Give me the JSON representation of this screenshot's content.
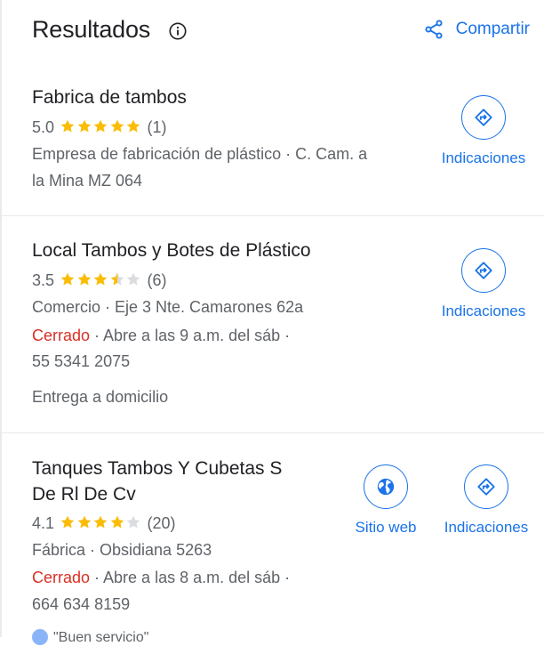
{
  "header": {
    "title": "Resultados",
    "share_label": "Compartir"
  },
  "results": [
    {
      "name": "Fabrica de tambos",
      "rating": "5.0",
      "stars": 5,
      "reviews": "(1)",
      "line1": "Empresa de fabricación de plástico · C. Cam. a",
      "line2": "la Mina MZ 064",
      "directions_label": "Indicaciones"
    },
    {
      "name": "Local Tambos y Botes de Plástico",
      "rating": "3.5",
      "stars": 3.5,
      "reviews": "(6)",
      "line1": "Comercio · Eje 3 Nte. Camarones 62a",
      "status": "Cerrado",
      "hours": " · Abre a las 9 a.m. del sáb ·",
      "phone": "55 5341 2075",
      "extra": "Entrega a domicilio",
      "directions_label": "Indicaciones"
    },
    {
      "name_line1": "Tanques Tambos Y Cubetas S",
      "name_line2": "De Rl De Cv",
      "rating": "4.1",
      "stars": 4,
      "reviews": "(20)",
      "line1": "Fábrica · Obsidiana 5263",
      "status": "Cerrado",
      "hours": " · Abre a las 8 a.m. del sáb ·",
      "phone": "664 634 8159",
      "website_label": "Sitio web",
      "directions_label": "Indicaciones",
      "cutoff_text": "\"Buen servicio\""
    }
  ],
  "colors": {
    "accent": "#1a73e8",
    "star": "#fbbc04",
    "closed": "#d93025"
  }
}
